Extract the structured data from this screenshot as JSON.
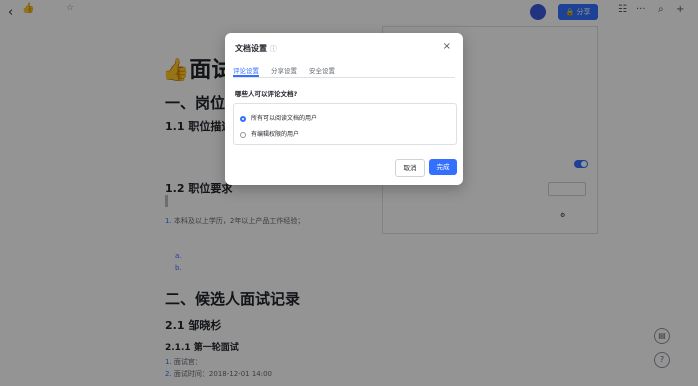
{
  "header": {
    "emoji": "👍",
    "avatar_text": "",
    "share_label": "分享"
  },
  "document": {
    "title_emoji": "👍",
    "title": "面试记",
    "h1_position": "一、岗位信",
    "h2_description": "1.1 职位描述",
    "h2_requirements": "1.2 职位要求",
    "req_item1_text": "本科及以上学历，2年以上产品工作经验；",
    "sub_a_marker": "a.",
    "sub_b_marker": "b.",
    "h1_candidates": "二、候选人面试记录",
    "h2_candidate": "2.1 邹晓杉",
    "h3_round1": "2.1.1 第一轮面试",
    "interviewer_label": "面试官：",
    "interview_time": "面试时间：2018-12-01 14:00"
  },
  "dialog": {
    "title": "文档设置",
    "tabs": [
      "评论设置",
      "分享设置",
      "安全设置"
    ],
    "question": "哪些人可以评论文档?",
    "option1": "所有可以阅读文档的用户",
    "option2": "有编辑权限的用户",
    "cancel_label": "取消",
    "ok_label": "完成"
  },
  "colors": {
    "accent": "#3370ff",
    "overlay": "rgba(0,0,0,0.42)"
  }
}
